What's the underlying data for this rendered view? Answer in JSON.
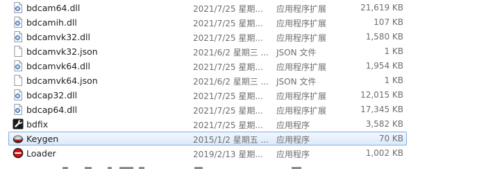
{
  "files": [
    {
      "name": "bdcam64.dll",
      "date": "2021/7/25 星期...",
      "type": "应用程序扩展",
      "size": "21,619 KB",
      "icon": "dll-file-icon"
    },
    {
      "name": "bdcamih.dll",
      "date": "2021/7/25 星期...",
      "type": "应用程序扩展",
      "size": "107 KB",
      "icon": "dll-file-icon"
    },
    {
      "name": "bdcamvk32.dll",
      "date": "2021/7/25 星期...",
      "type": "应用程序扩展",
      "size": "1,580 KB",
      "icon": "dll-file-icon"
    },
    {
      "name": "bdcamvk32.json",
      "date": "2021/6/2 星期三 ...",
      "type": "JSON 文件",
      "size": "1 KB",
      "icon": "json-file-icon"
    },
    {
      "name": "bdcamvk64.dll",
      "date": "2021/7/25 星期...",
      "type": "应用程序扩展",
      "size": "1,954 KB",
      "icon": "dll-file-icon"
    },
    {
      "name": "bdcamvk64.json",
      "date": "2021/6/2 星期三 ...",
      "type": "JSON 文件",
      "size": "1 KB",
      "icon": "json-file-icon"
    },
    {
      "name": "bdcap32.dll",
      "date": "2021/7/25 星期...",
      "type": "应用程序扩展",
      "size": "12,015 KB",
      "icon": "dll-file-icon"
    },
    {
      "name": "bdcap64.dll",
      "date": "2021/7/25 星期...",
      "type": "应用程序扩展",
      "size": "17,345 KB",
      "icon": "dll-file-icon"
    },
    {
      "name": "bdfix",
      "date": "2021/7/25 星期...",
      "type": "应用程序",
      "size": "3,582 KB",
      "icon": "wrench-app-icon"
    },
    {
      "name": "Keygen",
      "date": "2015/1/2 星期五 ...",
      "type": "应用程序",
      "size": "70 KB",
      "icon": "keygen-app-icon",
      "selected": true
    },
    {
      "name": "Loader",
      "date": "2019/2/13 星期...",
      "type": "应用程序",
      "size": "1,002 KB",
      "icon": "loader-app-icon"
    }
  ],
  "colors": {
    "selection_border": "#84acdd",
    "selection_fill": "#dbeafb",
    "secondary_text": "#6d6d6d"
  }
}
